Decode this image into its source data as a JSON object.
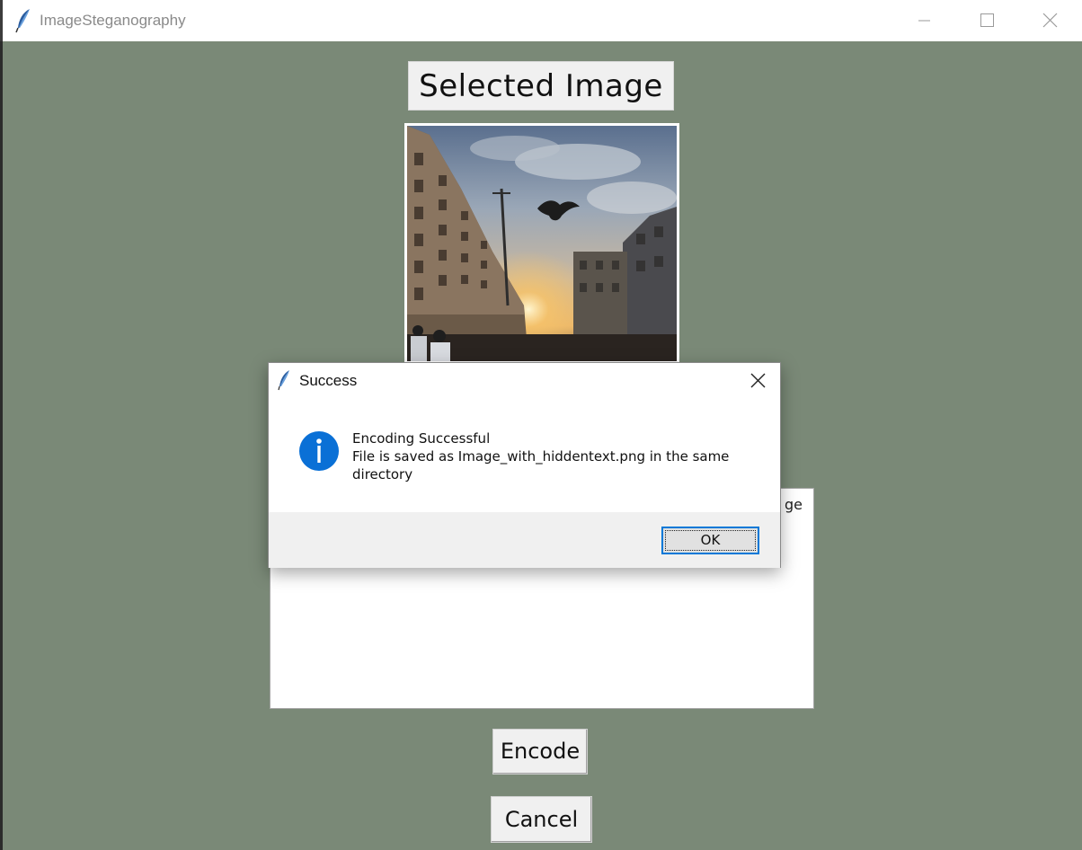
{
  "window": {
    "title": "ImageSteganography",
    "app_icon": "feather-icon",
    "controls": [
      "minimize-icon",
      "maximize-icon",
      "close-icon"
    ]
  },
  "main": {
    "heading": "Selected Image",
    "textarea_visible_fragment": "ge",
    "encode_label": "Encode",
    "cancel_label": "Cancel",
    "background_color": "#7a8977"
  },
  "dialog": {
    "title": "Success",
    "icon": "info-icon",
    "message_line1": "Encoding Successful",
    "message_line2": "File is saved as Image_with_hiddentext.png in the same",
    "message_line3": "directory",
    "ok_label": "OK",
    "accent_color": "#0078d7"
  }
}
